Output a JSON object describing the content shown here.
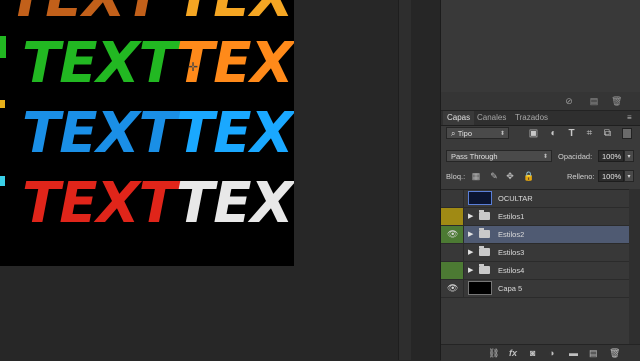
{
  "canvas": {
    "texts": [
      {
        "label": "TEXT",
        "color": "#d2691e"
      },
      {
        "label": "TEXT",
        "color": "#f5a623"
      },
      {
        "label": "TEXT",
        "color": "#22b822"
      },
      {
        "label": "TEXT",
        "color": "#ff8a1a"
      },
      {
        "label": "TEXT",
        "color": "#1a8fe6"
      },
      {
        "label": "TEXT",
        "color": "#1aa8ff"
      },
      {
        "label": "TEXT",
        "color": "#e0251a"
      },
      {
        "label": "TEXT",
        "color": "#e8e8e8"
      }
    ]
  },
  "panel": {
    "tabs": [
      "Capas",
      "Canales",
      "Trazados"
    ],
    "filter": {
      "value": "Tipo"
    },
    "blend": {
      "value": "Pass Through"
    },
    "opacity": {
      "label": "Opacidad:",
      "value": "100%"
    },
    "lock": {
      "label": "Bloq.:"
    },
    "fill": {
      "label": "Relleno:",
      "value": "100%"
    },
    "layers": [
      {
        "name": "OCULTAR",
        "visible": false,
        "type": "image",
        "label_color": ""
      },
      {
        "name": "Estilos1",
        "visible": false,
        "type": "group",
        "label_color": "#a08a14"
      },
      {
        "name": "Estilos2",
        "visible": true,
        "type": "group",
        "label_color": "#4c7a33",
        "selected": true
      },
      {
        "name": "Estilos3",
        "visible": false,
        "type": "group",
        "label_color": ""
      },
      {
        "name": "Estilos4",
        "visible": false,
        "type": "group",
        "label_color": "#4c7a33"
      },
      {
        "name": "Capa 5",
        "visible": true,
        "type": "black",
        "label_color": ""
      }
    ]
  }
}
